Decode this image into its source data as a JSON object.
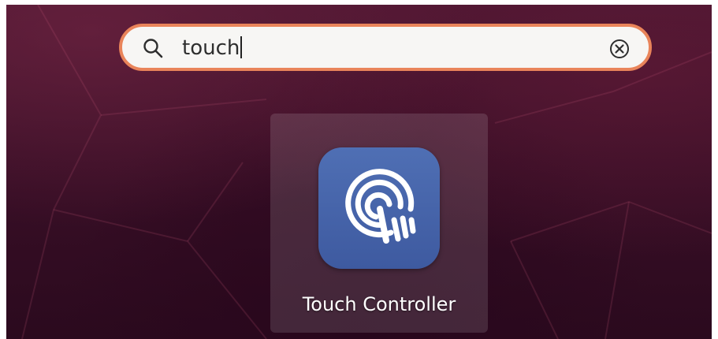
{
  "search": {
    "query": "touch"
  },
  "results": [
    {
      "label": "Touch Controller",
      "icon": "touch-controller-icon"
    }
  ],
  "colors": {
    "accent": "#e9845a",
    "search_bg": "#f7f6f4",
    "app_icon_bg": "#4f6fb4",
    "desktop_bg": "#3a0f27"
  }
}
